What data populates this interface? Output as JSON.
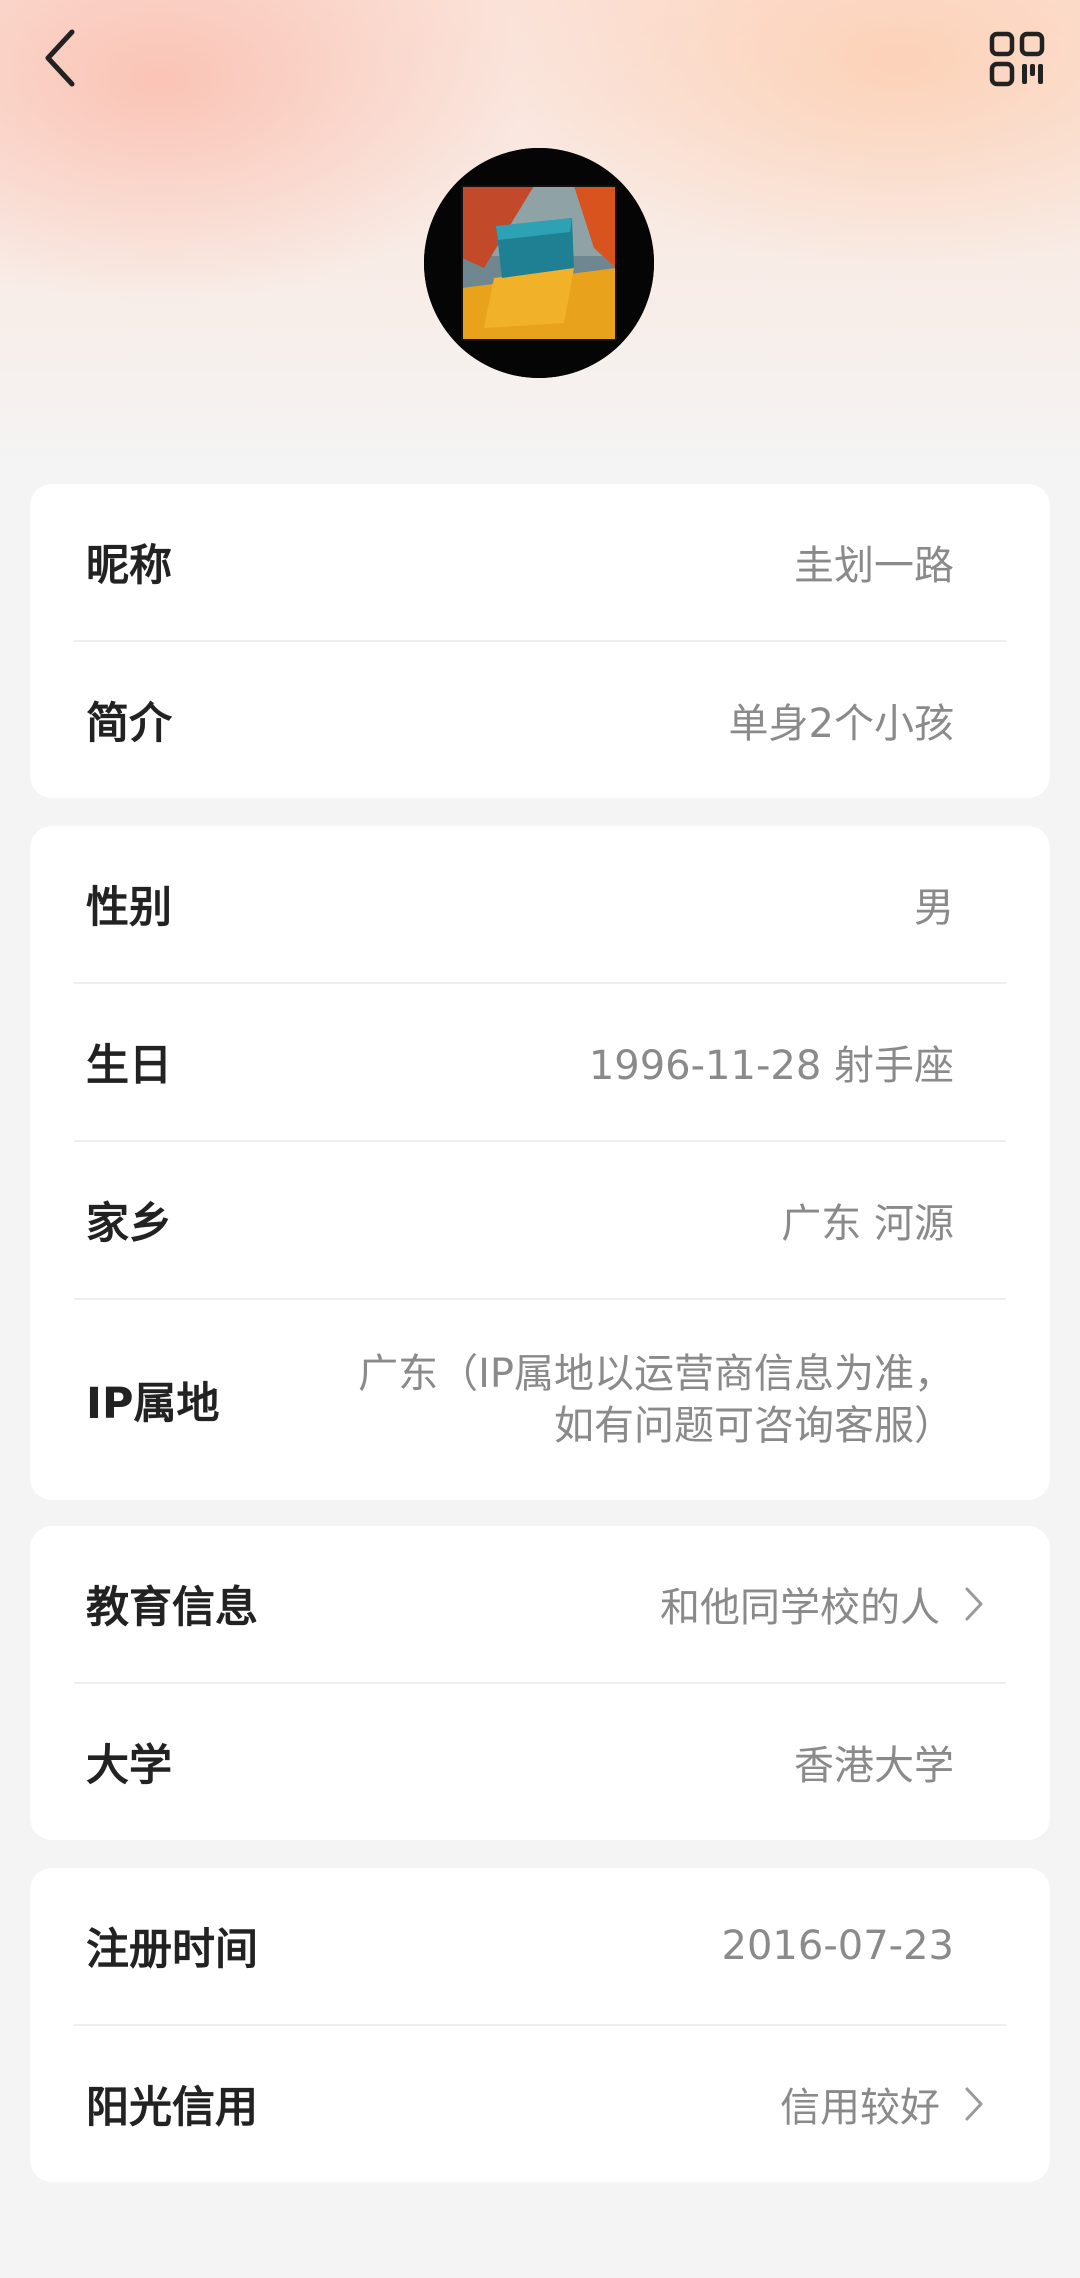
{
  "header": {
    "back_icon": "chevron-left-icon",
    "qr_icon": "qr-code-icon"
  },
  "profile_card": {
    "nickname_label": "昵称",
    "nickname_value": "圭划一路",
    "bio_label": "简介",
    "bio_value": "单身2个小孩"
  },
  "basic_card": {
    "gender_label": "性别",
    "gender_value": "男",
    "birthday_label": "生日",
    "birthday_value": "1996-11-28 射手座",
    "hometown_label": "家乡",
    "hometown_value": "广东 河源",
    "ip_label": "IP属地",
    "ip_value_line1": "广东（IP属地以运营商信息为准，",
    "ip_value_line2": "如有问题可咨询客服）"
  },
  "education_card": {
    "education_label": "教育信息",
    "education_value": "和他同学校的人",
    "university_label": "大学",
    "university_value": "香港大学"
  },
  "account_card": {
    "register_label": "注册时间",
    "register_value": "2016-07-23",
    "credit_label": "阳光信用",
    "credit_value": "信用较好"
  },
  "colors": {
    "background": "#f4f4f5",
    "card": "#ffffff",
    "label_text": "#222222",
    "value_text": "#8a8a8a"
  }
}
